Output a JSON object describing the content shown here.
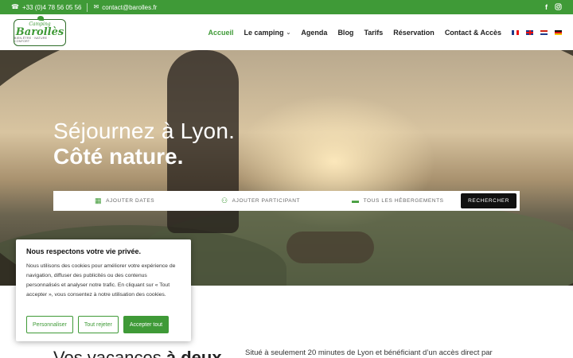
{
  "topbar": {
    "phone": "+33 (0)4 78 56 05 56",
    "email": "contact@barolles.fr",
    "social": [
      "facebook-icon",
      "instagram-icon"
    ]
  },
  "logo": {
    "line1": "Camping",
    "line2": "Barollès",
    "line3": "BIEN-ÊTRE · NATURE · CONFORT"
  },
  "nav": {
    "items": [
      {
        "label": "Accueil",
        "active": true
      },
      {
        "label": "Le camping",
        "dropdown": true
      },
      {
        "label": "Agenda"
      },
      {
        "label": "Blog"
      },
      {
        "label": "Tarifs"
      },
      {
        "label": "Réservation"
      },
      {
        "label": "Contact & Accès"
      }
    ],
    "flags": [
      "fr",
      "gb",
      "nl",
      "de"
    ]
  },
  "hero": {
    "title_line1": "Séjournez à Lyon.",
    "title_line2": "Côté nature."
  },
  "search": {
    "dates": "AJOUTER DATES",
    "participants": "AJOUTER PARTICIPANT",
    "lodging": "TOUS LES HÉBERGEMENTS",
    "button": "RECHERCHER"
  },
  "section": {
    "heading_regular": "Vos vacances ",
    "heading_bold": "à deux",
    "paragraph": "Situé à seulement 20 minutes de Lyon et bénéficiant d’un accès direct par"
  },
  "cookie": {
    "title": "Nous respectons votre vie privée.",
    "text": "Nous utilisons des cookies pour améliorer votre expérience de navigation, diffuser des publicités ou des contenus personnalisés et analyser notre trafic. En cliquant sur « Tout accepter », vous consentez à notre utilisation des cookies.",
    "btn_customize": "Personnaliser",
    "btn_reject": "Tout rejeter",
    "btn_accept": "Accepter tout"
  },
  "colors": {
    "brand_green": "#3f9a37",
    "dark": "#111111"
  }
}
